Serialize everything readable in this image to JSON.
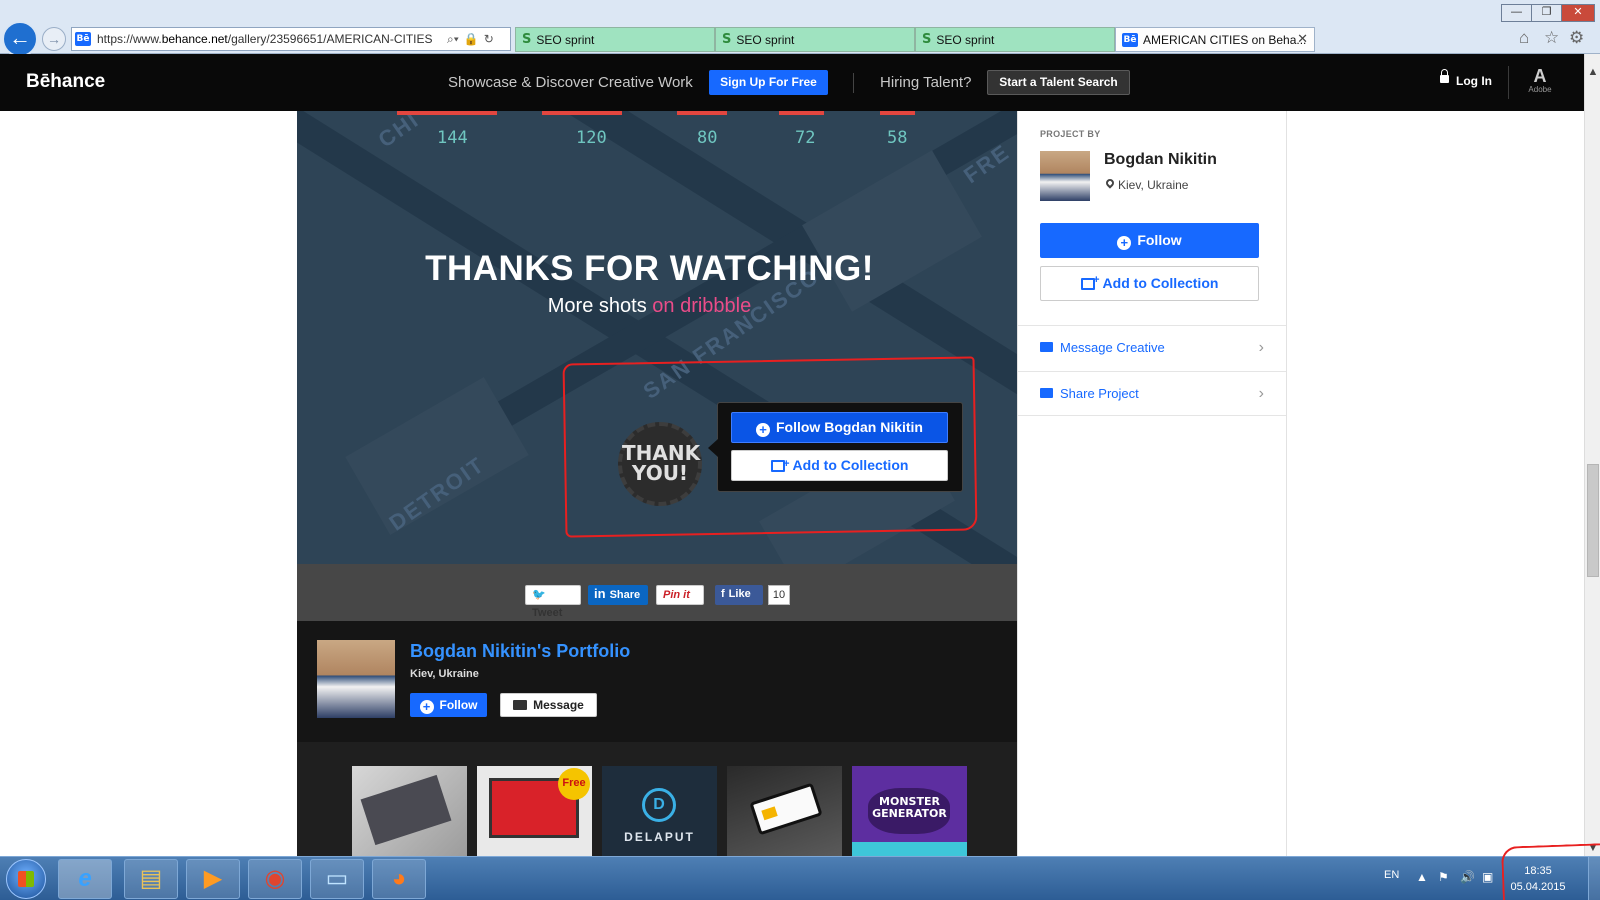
{
  "browser": {
    "url_prefix": "https://www.",
    "url_domain": "behance.net",
    "url_path": "/gallery/23596651/AMERICAN-CITIES",
    "back_label": "←",
    "forward_label": "→",
    "tabs": [
      {
        "label": "SEO sprint"
      },
      {
        "label": "SEO sprint"
      },
      {
        "label": "SEO sprint"
      },
      {
        "label": "AMERICAN CITIES on Beha..."
      }
    ],
    "tab_close": "✕",
    "window_buttons": [
      "—",
      "❐",
      "✕"
    ],
    "favicon_behance": "Bē",
    "favicon_seo": "S",
    "icons": [
      "home-icon",
      "favorites-star-icon",
      "tools-gear-icon"
    ]
  },
  "header": {
    "logo": "Bēhance",
    "tagline": "Showcase & Discover Creative Work",
    "signup": "Sign Up For Free",
    "hiring": "Hiring Talent?",
    "talent_search": "Start a Talent Search",
    "login": "Log In",
    "adobe_mark": "A",
    "adobe_text": "Adobe"
  },
  "project": {
    "stats": [
      "144",
      "120",
      "80",
      "72",
      "58"
    ],
    "thanks_title": "THANKS FOR WATCHING!",
    "more_shots_prefix": "More shots",
    "more_shots_link": "on dribbble",
    "map_labels": [
      "CHI",
      "SAN FRANCISCO",
      "DETROIT",
      "FRE"
    ],
    "thank_you": [
      "THANK",
      "YOU!"
    ],
    "cta_follow": "Follow Bogdan Nikitin",
    "cta_collection": "Add to Collection"
  },
  "share": {
    "tweet": "Tweet",
    "linkedin": "Share",
    "pinit": "Pin it",
    "like": "Like",
    "like_count": "10"
  },
  "owner": {
    "portfolio": "Bogdan Nikitin's Portfolio",
    "location": "Kiev, Ukraine",
    "follow": "Follow",
    "message": "Message"
  },
  "thumbs": {
    "free_badge": "Free",
    "delaput": "DELAPUT",
    "monster": [
      "MONSTER",
      "GENERATOR"
    ]
  },
  "sidebar": {
    "project_by": "PROJECT BY",
    "name": "Bogdan Nikitin",
    "location": "Kiev, Ukraine",
    "follow": "Follow",
    "add_collection": "Add to Collection",
    "message_creative": "Message Creative",
    "share_project": "Share Project"
  },
  "taskbar": {
    "language": "EN",
    "time": "18:35",
    "date": "05.04.2015"
  },
  "colors": {
    "behance_blue": "#1769ff",
    "dribbble_pink": "#ea4c89",
    "art_background": "#2e4456",
    "annotation_red": "#e82020"
  }
}
